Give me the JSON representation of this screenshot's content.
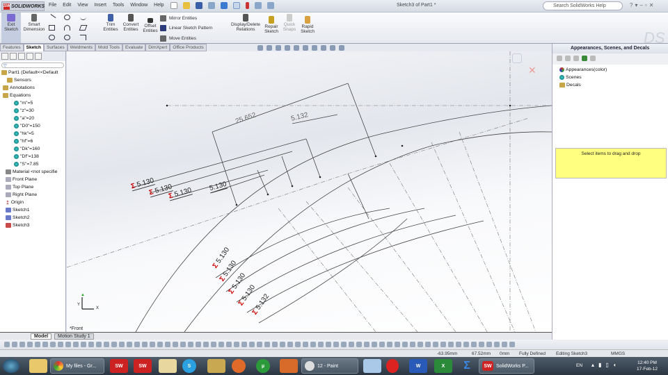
{
  "app": {
    "logo": "SOLIDWORKS",
    "document_title": "Sketch3 of Part1 *"
  },
  "menu": [
    "File",
    "Edit",
    "View",
    "Insert",
    "Tools",
    "Window",
    "Help"
  ],
  "search": {
    "placeholder": "Search SolidWorks Help"
  },
  "ribbon": {
    "exit_sketch": "Exit Sketch",
    "smart_dimension": "Smart Dimension",
    "trim_entities": "Trim Entities",
    "convert_entities": "Convert Entities",
    "offset_entities": "Offset Entities",
    "mirror_entities": "Mirror Entities",
    "linear_sketch_pattern": "Linear Sketch Pattern",
    "move_entities": "Move Entities",
    "display_delete_relations": "Display/Delete Relations",
    "repair_sketch": "Repair Sketch",
    "quick_snaps": "Quick Snaps",
    "rapid_sketch": "Rapid Sketch"
  },
  "tabs": [
    "Features",
    "Sketch",
    "Surfaces",
    "Weldments",
    "Mold Tools",
    "Evaluate",
    "DimXpert",
    "Office Products"
  ],
  "active_tab": "Sketch",
  "tree": {
    "root": "Part1  (Default<<Default",
    "items": [
      "Sensors",
      "Annotations",
      "Equations"
    ],
    "equations": [
      "\"m\"=5",
      "\"z\"=30",
      "\"a\"=20",
      "\"D0\"=150",
      "\"hk\"=5",
      "\"hf\"=6",
      "\"Dk\"=160",
      "\"Df\"=138",
      "\"S\"=7.85"
    ],
    "features": [
      "Material <not specifie",
      "Front Plane",
      "Top Plane",
      "Right Plane",
      "Origin",
      "Sketch1",
      "Sketch2",
      "Sketch3"
    ]
  },
  "dimensions": {
    "total": "25.652",
    "top": "5.132",
    "upper_left": [
      "5.130",
      "5.130",
      "5.130"
    ],
    "upper_plain": "5.130",
    "lower": [
      "5.130",
      "5.130",
      "5.130",
      "5.130",
      "5.132"
    ],
    "sigma": "Σ"
  },
  "view_label": "*Front",
  "axis": {
    "x": "X",
    "y": "Y"
  },
  "right_panel": {
    "title": "Appearances, Scenes, and Decals",
    "items": [
      "Appearances(color)",
      "Scenes",
      "Decals"
    ],
    "drag_hint": "Select items to drag and drop"
  },
  "bottom_tabs": [
    "Model",
    "Motion Study 1"
  ],
  "status": {
    "x": "-63.95mm",
    "y": "67.52mm",
    "z": "0mm",
    "state": "Fully Defined",
    "editing": "Editing Sketch3",
    "units": "MMGS"
  },
  "taskbar": {
    "chrome": "My files - Gr...",
    "paint": "12 - Paint",
    "solidworks": "SolidWorks P...",
    "lang": "EN",
    "time": "12:40 PM",
    "date": "17-Feb-12"
  }
}
